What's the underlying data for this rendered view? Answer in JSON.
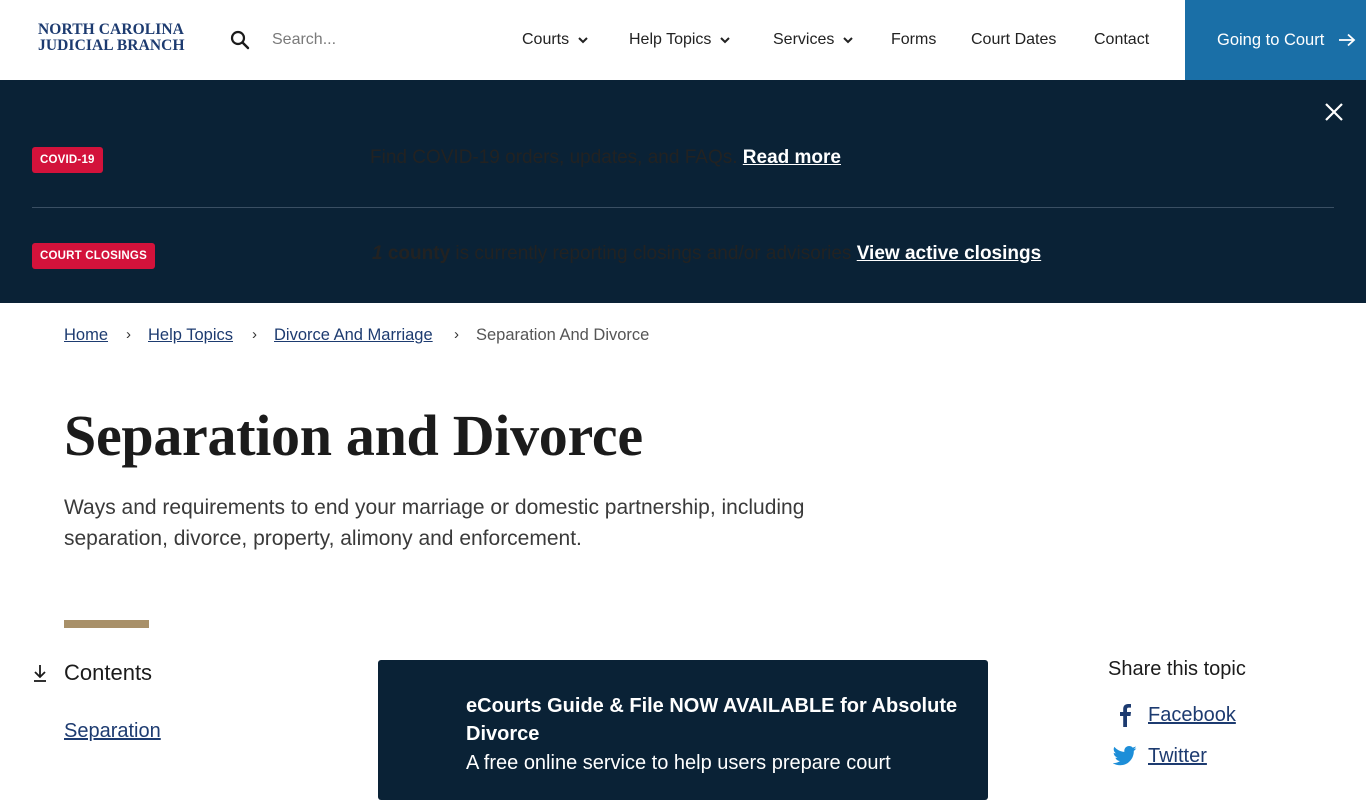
{
  "header": {
    "logo_line1": "NORTH CAROLINA",
    "logo_line2": "JUDICIAL BRANCH",
    "search_placeholder": "Search...",
    "nav": {
      "courts": "Courts",
      "help_topics": "Help Topics",
      "services": "Services",
      "forms": "Forms",
      "court_dates": "Court Dates",
      "contact": "Contact"
    },
    "going_to_court": "Going to Court",
    "accent_color": "#1a6fa7"
  },
  "alerts": {
    "background": "#0a2236",
    "covid": {
      "badge": "COVID-19",
      "text": "Find COVID-19 orders, updates, and FAQs.",
      "link": "Read more"
    },
    "closings": {
      "badge": "COURT CLOSINGS",
      "count": "1",
      "count_label": "county",
      "text": "is currently reporting closings and/or advisories",
      "link": "View active closings"
    },
    "badge_color": "#d3123b"
  },
  "breadcrumb": {
    "home": "Home",
    "help_topics": "Help Topics",
    "divorce_marriage": "Divorce And Marriage",
    "current": "Separation And Divorce"
  },
  "page": {
    "title": "Separation and Divorce",
    "lede": "Ways and requirements to end your marriage or domestic partnership, including separation, divorce, property, alimony and enforcement."
  },
  "contents": {
    "title": "Contents",
    "items": [
      "Separation"
    ]
  },
  "card": {
    "title": "eCourts Guide & File NOW AVAILABLE for Absolute Divorce",
    "desc": "A free online service to help users prepare court"
  },
  "share": {
    "title": "Share this topic",
    "facebook": "Facebook",
    "twitter": "Twitter"
  }
}
